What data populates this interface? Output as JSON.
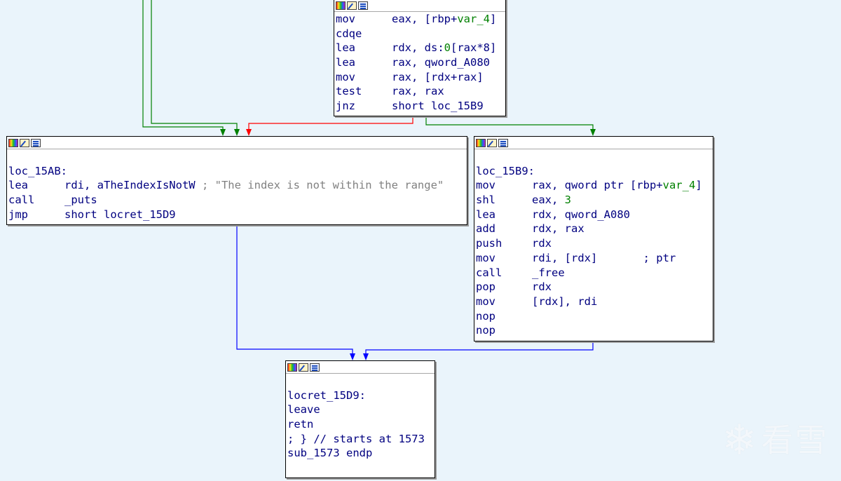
{
  "colors": {
    "background": "#eaf4fb",
    "text": "#000080",
    "number": "#008000",
    "comment": "#808080",
    "edge_true": "#008000",
    "edge_false": "#ff0000",
    "edge_flow": "#0000ff"
  },
  "header_icons": [
    "node-color-icon",
    "rename-node-icon",
    "group-nodes-icon"
  ],
  "blocks": {
    "top": {
      "lines": [
        {
          "mn": "mov",
          "op_pre": "eax, [rbp+",
          "op_num": "var_4",
          "op_post": "]"
        },
        {
          "mn": "cdqe",
          "op_pre": "",
          "op_num": "",
          "op_post": ""
        },
        {
          "mn": "lea",
          "op_pre": "rdx, ds:",
          "op_num": "0",
          "op_post": "[rax*8]"
        },
        {
          "mn": "lea",
          "op_pre": "rax, qword_A080",
          "op_num": "",
          "op_post": ""
        },
        {
          "mn": "mov",
          "op_pre": "rax, [rdx+rax]",
          "op_num": "",
          "op_post": ""
        },
        {
          "mn": "test",
          "op_pre": "rax, rax",
          "op_num": "",
          "op_post": ""
        },
        {
          "mn": "jnz",
          "op_pre": "short loc_15B9",
          "op_num": "",
          "op_post": ""
        }
      ]
    },
    "loc_15AB": {
      "label": "loc_15AB:",
      "lines": [
        {
          "mn": "lea",
          "op": "rdi, aTheIndexIsNotW",
          "comment": " ; \"The index is not within the range\""
        },
        {
          "mn": "call",
          "op": "_puts",
          "comment": ""
        },
        {
          "mn": "jmp",
          "op": "short locret_15D9",
          "comment": ""
        }
      ]
    },
    "loc_15B9": {
      "label": "loc_15B9:",
      "lines": [
        {
          "mn": "mov",
          "op_pre": "rax, qword ptr [rbp+",
          "op_num": "var_4",
          "op_post": "]"
        },
        {
          "mn": "shl",
          "op_pre": "eax, ",
          "op_num": "3",
          "op_post": ""
        },
        {
          "mn": "lea",
          "op_pre": "rdx, qword_A080",
          "op_num": "",
          "op_post": ""
        },
        {
          "mn": "add",
          "op_pre": "rdx, rax",
          "op_num": "",
          "op_post": ""
        },
        {
          "mn": "push",
          "op_pre": "rdx",
          "op_num": "",
          "op_post": ""
        },
        {
          "mn": "mov",
          "op_pre": "rdi, [rdx]       ; ptr",
          "op_num": "",
          "op_post": ""
        },
        {
          "mn": "call",
          "op_pre": "_free",
          "op_num": "",
          "op_post": ""
        },
        {
          "mn": "pop",
          "op_pre": "rdx",
          "op_num": "",
          "op_post": ""
        },
        {
          "mn": "mov",
          "op_pre": "[rdx], rdi",
          "op_num": "",
          "op_post": ""
        },
        {
          "mn": "nop",
          "op_pre": "",
          "op_num": "",
          "op_post": ""
        },
        {
          "mn": "nop",
          "op_pre": "",
          "op_num": "",
          "op_post": ""
        }
      ]
    },
    "locret_15D9": {
      "label": "locret_15D9:",
      "lines": [
        "leave",
        "retn",
        "; } // starts at 1573",
        "sub_1573 endp"
      ]
    }
  },
  "watermark": {
    "icon": "snowflake-icon",
    "text": "看雪"
  }
}
